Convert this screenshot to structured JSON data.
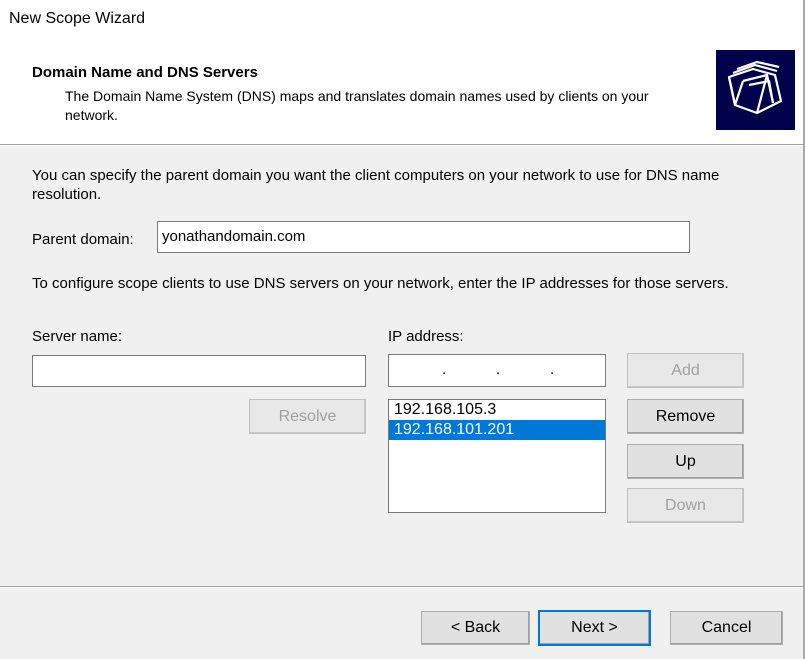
{
  "window": {
    "title": "New Scope Wizard"
  },
  "header": {
    "title": "Domain Name and DNS Servers",
    "description": "The Domain Name System (DNS) maps and translates domain names used by clients on your network.",
    "icon": "folder-stack-icon"
  },
  "content": {
    "intro": "You can specify the parent domain you want the client computers on your network to use for DNS name resolution.",
    "parent_domain_label": "Parent domain:",
    "parent_domain_value": "yonathandomain.com",
    "dns_instructions": "To configure scope clients to use DNS servers on your network, enter the IP addresses for those servers.",
    "server_name_label": "Server name:",
    "server_name_value": "",
    "ip_address_label": "IP address:",
    "ip_address_dots": [
      ".",
      ".",
      "."
    ],
    "resolve_label": "Resolve",
    "add_label": "Add",
    "remove_label": "Remove",
    "up_label": "Up",
    "down_label": "Down",
    "ip_list": [
      {
        "value": "192.168.105.3",
        "selected": false
      },
      {
        "value": "192.168.101.201",
        "selected": true
      }
    ]
  },
  "footer": {
    "back_label": "< Back",
    "next_label": "Next >",
    "cancel_label": "Cancel"
  },
  "colors": {
    "selection": "#0078d7",
    "icon_background": "#00004b",
    "dialog_background": "#f0f0f0"
  }
}
